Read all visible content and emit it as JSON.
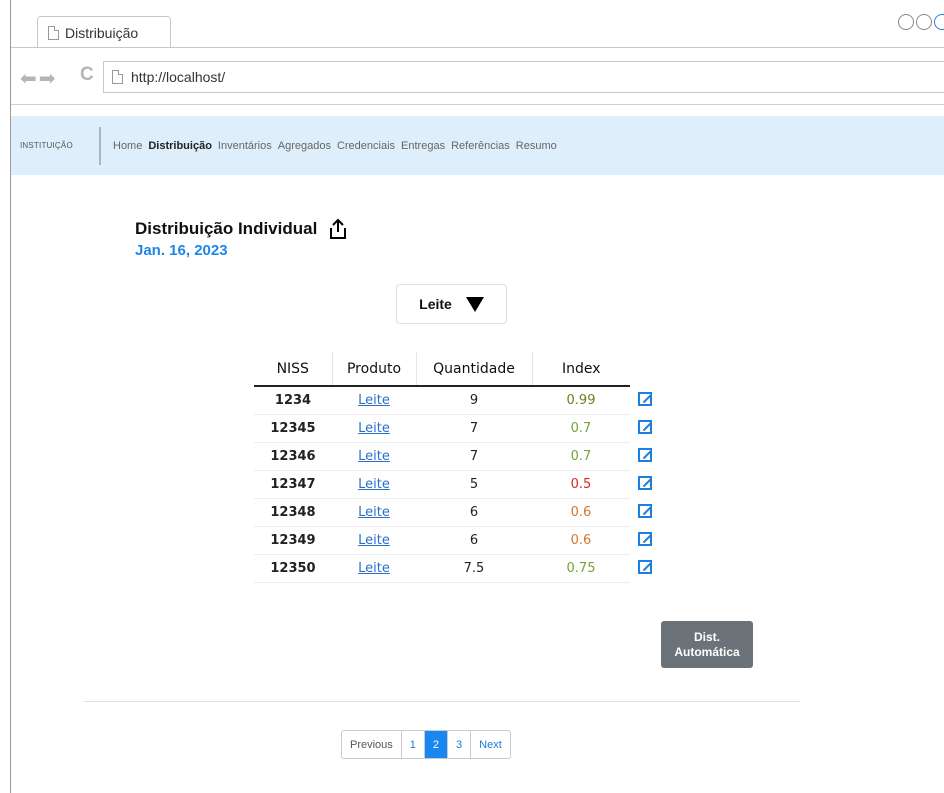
{
  "browser": {
    "tab_title": "Distribuição",
    "url": "http://localhost/"
  },
  "navbar": {
    "brand": "INSTITUIÇÃO",
    "links": [
      "Home",
      "Distribuição",
      "Inventários",
      "Agregados",
      "Credenciais",
      "Entregas",
      "Referências",
      "Resumo"
    ],
    "active": "Distribuição"
  },
  "page": {
    "title": "Distribuição Individual",
    "date": "Jan. 16, 2023"
  },
  "filter": {
    "selected": "Leite"
  },
  "table": {
    "headers": [
      "NISS",
      "Produto",
      "Quantidade",
      "Index"
    ],
    "rows": [
      {
        "niss": "1234",
        "produto": "Leite",
        "quantidade": "9",
        "index": "0.99",
        "index_color": "#6e7f1c"
      },
      {
        "niss": "12345",
        "produto": "Leite",
        "quantidade": "7",
        "index": "0.7",
        "index_color": "#74a33a"
      },
      {
        "niss": "12346",
        "produto": "Leite",
        "quantidade": "7",
        "index": "0.7",
        "index_color": "#74a33a"
      },
      {
        "niss": "12347",
        "produto": "Leite",
        "quantidade": "5",
        "index": "0.5",
        "index_color": "#d42a1e"
      },
      {
        "niss": "12348",
        "produto": "Leite",
        "quantidade": "6",
        "index": "0.6",
        "index_color": "#d6772a"
      },
      {
        "niss": "12349",
        "produto": "Leite",
        "quantidade": "6",
        "index": "0.6",
        "index_color": "#d6772a"
      },
      {
        "niss": "12350",
        "produto": "Leite",
        "quantidade": "7.5",
        "index": "0.75",
        "index_color": "#74a33a"
      }
    ]
  },
  "actions": {
    "auto_line1": "Dist.",
    "auto_line2": "Automática"
  },
  "pagination": {
    "previous": "Previous",
    "pages": [
      "1",
      "2",
      "3"
    ],
    "current": "2",
    "next": "Next"
  },
  "colors": {
    "accent": "#1e86e8",
    "navbar_bg": "#deeefa",
    "button_bg": "#6b7378"
  }
}
